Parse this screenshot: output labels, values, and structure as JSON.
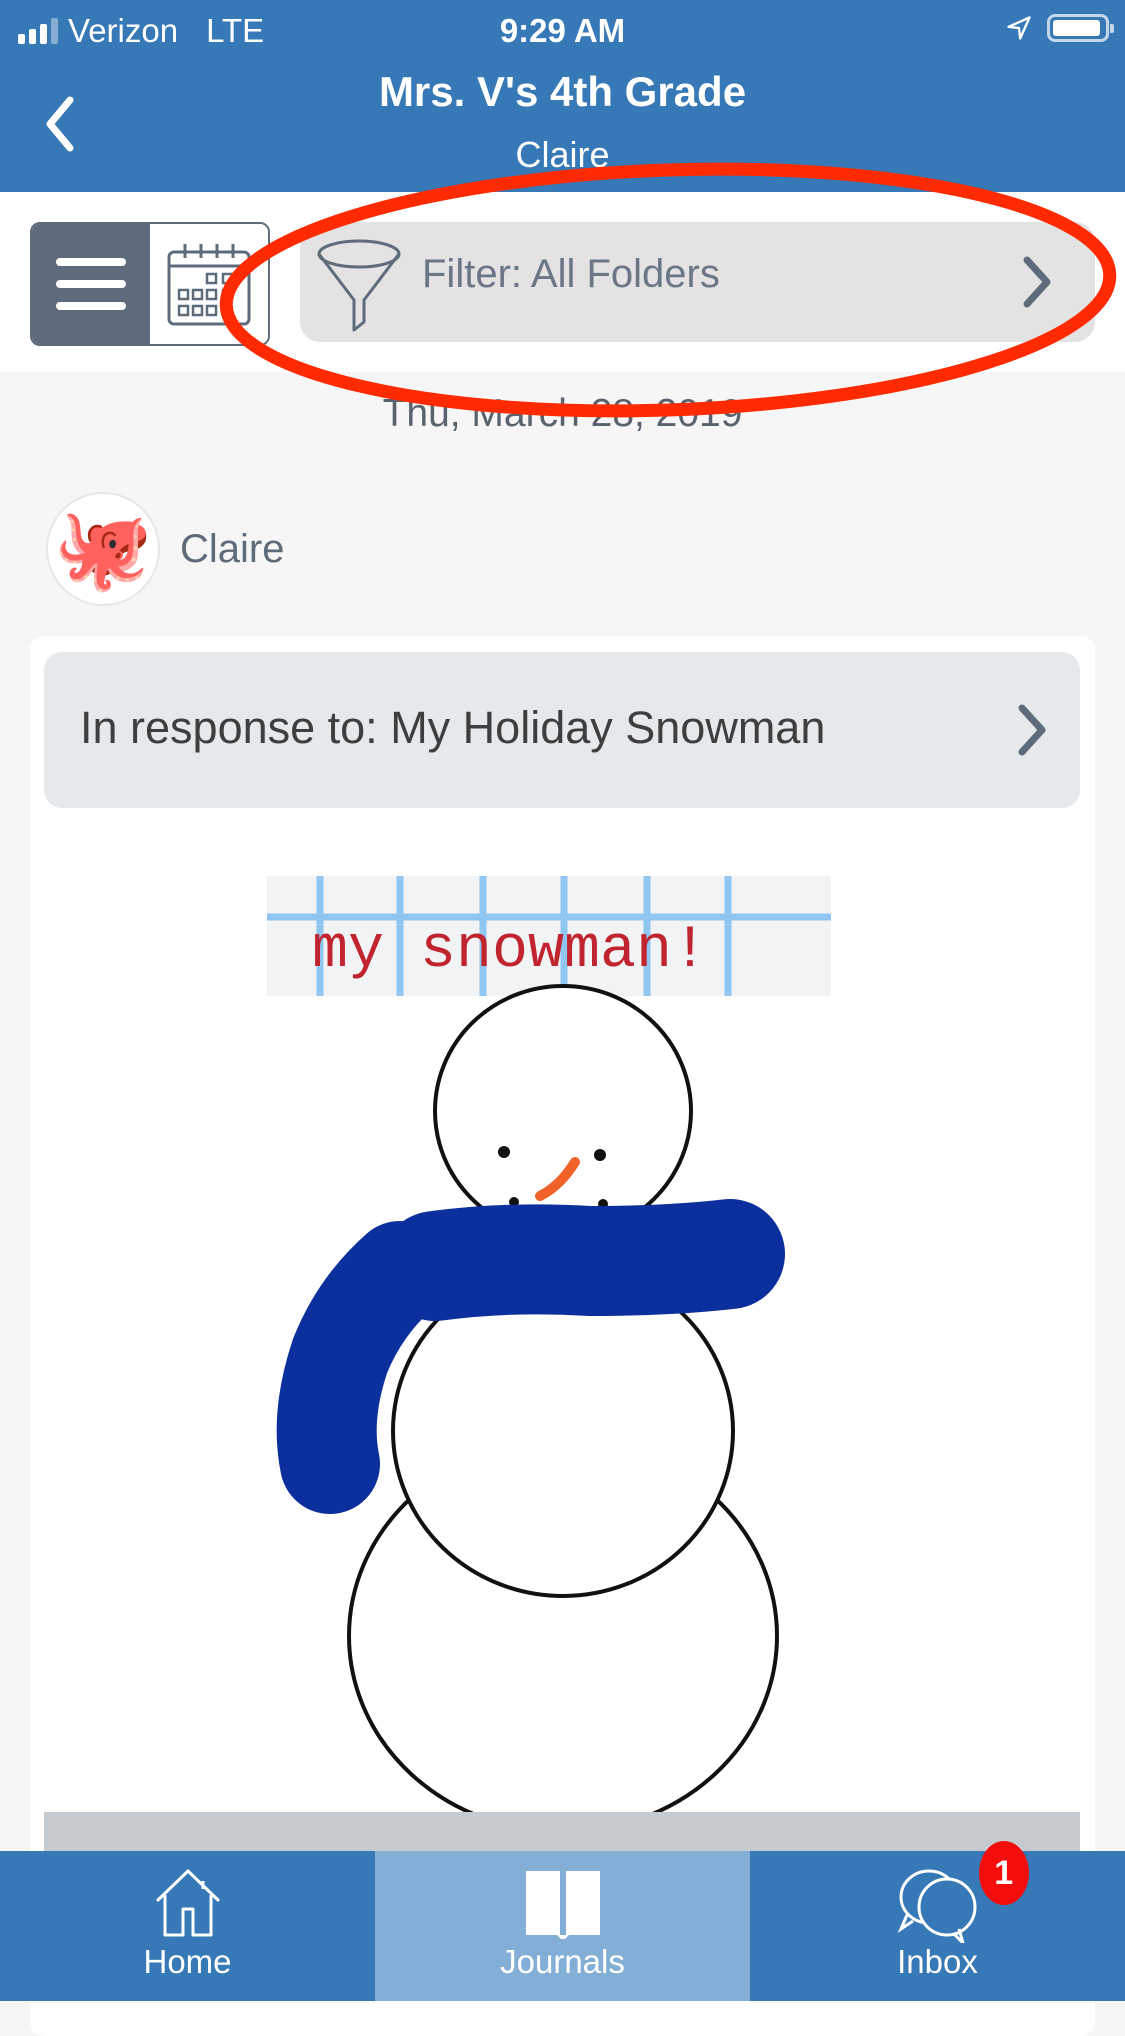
{
  "status_bar": {
    "carrier": "Verizon",
    "network": "LTE",
    "time": "9:29 AM",
    "signal_bars": 3,
    "signal_max": 4,
    "location_icon": "location-arrow-icon",
    "battery_icon": "battery-icon"
  },
  "header": {
    "title": "Mrs. V's 4th Grade",
    "subtitle": "Claire",
    "back_icon": "chevron-left-icon"
  },
  "toolbar": {
    "menu_icon": "hamburger-icon",
    "calendar_icon": "calendar-icon",
    "filter_icon": "funnel-icon",
    "filter_label": "Filter: All Folders"
  },
  "feed": {
    "date": "Thu, March 28, 2019",
    "author_name": "Claire",
    "avatar_emoji": "🐙",
    "response_label": "In response to: My Holiday Snowman",
    "drawing_caption": "my snowman!"
  },
  "tabs": [
    {
      "label": "Home",
      "icon": "home-icon",
      "active": false
    },
    {
      "label": "Journals",
      "icon": "book-icon",
      "active": true
    },
    {
      "label": "Inbox",
      "icon": "chat-bubbles-icon",
      "active": false,
      "badge": "1"
    }
  ],
  "colors": {
    "brand_blue": "#3679b6",
    "active_tab": "#83aed5",
    "badge_red": "#f30d0b",
    "annotation_red": "#ff2a00",
    "scarf_blue": "#0b2f9c",
    "nose_orange": "#f0622a"
  }
}
